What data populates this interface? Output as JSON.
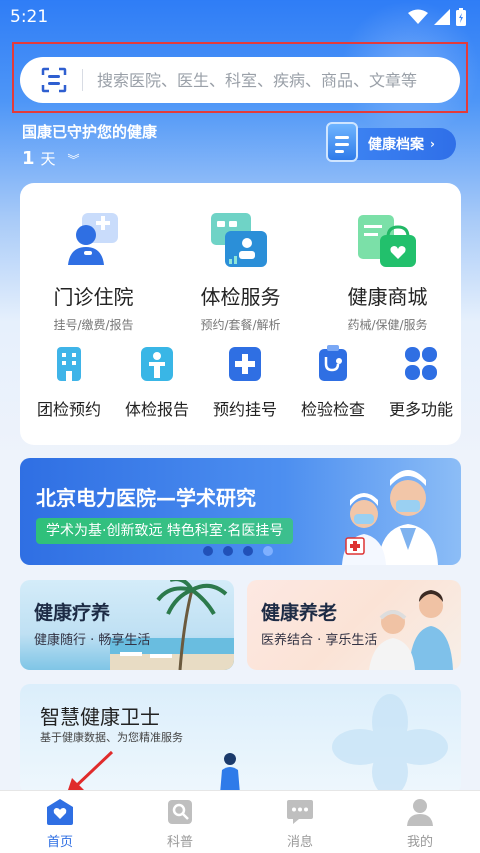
{
  "status_bar": {
    "time": "5:21"
  },
  "search": {
    "placeholder": "搜索医院、医生、科室、疾病、商品、文章等"
  },
  "guard": {
    "text": "国康已守护您的健康",
    "days_number": "1",
    "days_unit": "天"
  },
  "health_record": {
    "label": "健康档案"
  },
  "main_services": [
    {
      "title": "门诊住院",
      "subtitle": "挂号/缴费/报告",
      "icon": "doctor-plus-icon"
    },
    {
      "title": "体检服务",
      "subtitle": "预约/套餐/解析",
      "icon": "checkup-id-icon"
    },
    {
      "title": "健康商城",
      "subtitle": "药械/保健/服务",
      "icon": "shopping-bag-heart-icon"
    }
  ],
  "quick_services": [
    {
      "label": "团检预约",
      "icon": "building-icon"
    },
    {
      "label": "体检报告",
      "icon": "person-report-icon"
    },
    {
      "label": "预约挂号",
      "icon": "plus-register-icon"
    },
    {
      "label": "检验检查",
      "icon": "stethoscope-icon"
    },
    {
      "label": "更多功能",
      "icon": "grid-more-icon"
    }
  ],
  "banner": {
    "title": "北京电力医院—学术研究",
    "tag": "学术为基·创新致远  特色科室·名医挂号",
    "slides": 4,
    "active_slide": 4
  },
  "cards": {
    "convalescence": {
      "title": "健康疗养",
      "subtitle": "健康随行 · 畅享生活"
    },
    "elderly": {
      "title": "健康养老",
      "subtitle": "医养结合 · 享乐生活"
    }
  },
  "guardian": {
    "title": "智慧健康卫士",
    "subtitle": "基于健康数据、为您精准服务"
  },
  "tabbar": [
    {
      "label": "首页",
      "icon": "home-heart-icon",
      "active": true
    },
    {
      "label": "科普",
      "icon": "book-icon",
      "active": false
    },
    {
      "label": "消息",
      "icon": "chat-bubble-icon",
      "active": false
    },
    {
      "label": "我的",
      "icon": "user-icon",
      "active": false
    }
  ],
  "colors": {
    "primary": "#2f6fe3",
    "highlight_box": "#e33b3b",
    "annotation_arrow": "#e02b2b"
  }
}
